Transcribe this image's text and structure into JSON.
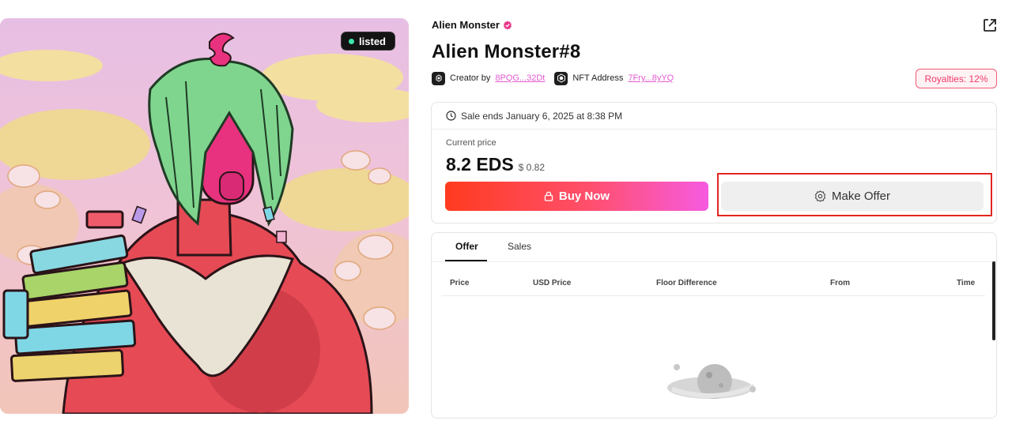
{
  "artwork": {
    "badge_label": "listed",
    "badge_dot_color": "#3ee6a8"
  },
  "collection": {
    "name": "Alien Monster",
    "verified_icon": "verified-badge-icon",
    "accent": "#e8368a"
  },
  "nft": {
    "title": "Alien Monster#8",
    "creator_label": "Creator by",
    "creator_address": "8PQG...32Dt",
    "address_label": "NFT Address",
    "nft_address": "7Fry...8yYQ",
    "royalties": "Royalties: 12%"
  },
  "sale": {
    "ends_text": "Sale ends January 6, 2025 at 8:38 PM",
    "current_price_label": "Current price",
    "price": "8.2 EDS",
    "usd_price": "$ 0.82",
    "buy_label": "Buy Now",
    "offer_label": "Make Offer",
    "buy_gradient": [
      "#ff3b1f",
      "#ff4f6d",
      "#f65be0"
    ]
  },
  "activity": {
    "tabs": [
      {
        "label": "Offer",
        "active": true
      },
      {
        "label": "Sales",
        "active": false
      }
    ],
    "columns": [
      "Price",
      "USD Price",
      "Floor Difference",
      "From",
      "Time"
    ]
  },
  "icons": {
    "share": "share-icon",
    "creator": "creator-icon",
    "nft_address": "hexagon-icon",
    "clock": "clock-icon",
    "lock": "lock-icon",
    "offer": "offer-icon",
    "empty": "planet-empty-icon"
  }
}
